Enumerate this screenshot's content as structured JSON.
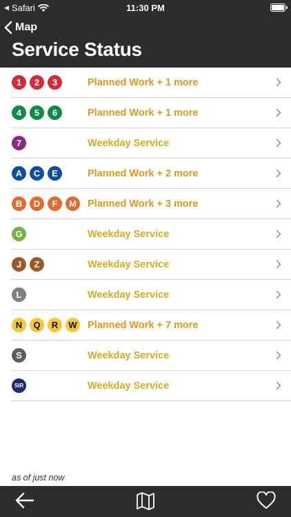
{
  "status_bar": {
    "carrier": "Safari",
    "time": "11:30 PM"
  },
  "nav": {
    "back_label": "Map",
    "title": "Service Status"
  },
  "lines": [
    {
      "bullets": [
        {
          "label": "1",
          "color": "#d52b39"
        },
        {
          "label": "2",
          "color": "#d52b39"
        },
        {
          "label": "3",
          "color": "#d52b39"
        }
      ],
      "status": "Planned Work + 1 more"
    },
    {
      "bullets": [
        {
          "label": "4",
          "color": "#0e8c46"
        },
        {
          "label": "5",
          "color": "#0e8c46"
        },
        {
          "label": "6",
          "color": "#0e8c46"
        }
      ],
      "status": "Planned Work + 1 more"
    },
    {
      "bullets": [
        {
          "label": "7",
          "color": "#8a2b83"
        }
      ],
      "status": "Weekday Service"
    },
    {
      "bullets": [
        {
          "label": "A",
          "color": "#0b4ea2"
        },
        {
          "label": "C",
          "color": "#0b4ea2"
        },
        {
          "label": "E",
          "color": "#0b4ea2"
        }
      ],
      "status": "Planned Work + 2 more"
    },
    {
      "bullets": [
        {
          "label": "B",
          "color": "#e36a2e"
        },
        {
          "label": "D",
          "color": "#e36a2e"
        },
        {
          "label": "F",
          "color": "#e36a2e"
        },
        {
          "label": "M",
          "color": "#e36a2e"
        }
      ],
      "status": "Planned Work + 3 more"
    },
    {
      "bullets": [
        {
          "label": "G",
          "color": "#70b441"
        }
      ],
      "status": "Weekday Service"
    },
    {
      "bullets": [
        {
          "label": "J",
          "color": "#9a5a24"
        },
        {
          "label": "Z",
          "color": "#9a5a24"
        }
      ],
      "status": "Weekday Service"
    },
    {
      "bullets": [
        {
          "label": "L",
          "color": "#7f7f7f"
        }
      ],
      "status": "Weekday Service"
    },
    {
      "bullets": [
        {
          "label": "N",
          "color": "#f7c635",
          "dark": true
        },
        {
          "label": "Q",
          "color": "#f7c635",
          "dark": true
        },
        {
          "label": "R",
          "color": "#f7c635",
          "dark": true
        },
        {
          "label": "W",
          "color": "#f7c635",
          "dark": true
        }
      ],
      "status": "Planned Work + 7 more"
    },
    {
      "bullets": [
        {
          "label": "S",
          "color": "#5e5e5e"
        }
      ],
      "status": "Weekday Service"
    },
    {
      "bullets": [
        {
          "label": "SIR",
          "color": "#1d2a6b",
          "small": true
        }
      ],
      "status": "Weekday Service"
    }
  ],
  "colors": {
    "planned_work": "#e09a1a",
    "weekday_service": "#d4ad1c",
    "chevron": "#8a8a8a"
  },
  "footer": {
    "timestamp": "as of just now"
  },
  "toolbar": {
    "icons": [
      "back-arrow-icon",
      "map-icon",
      "heart-icon"
    ]
  }
}
